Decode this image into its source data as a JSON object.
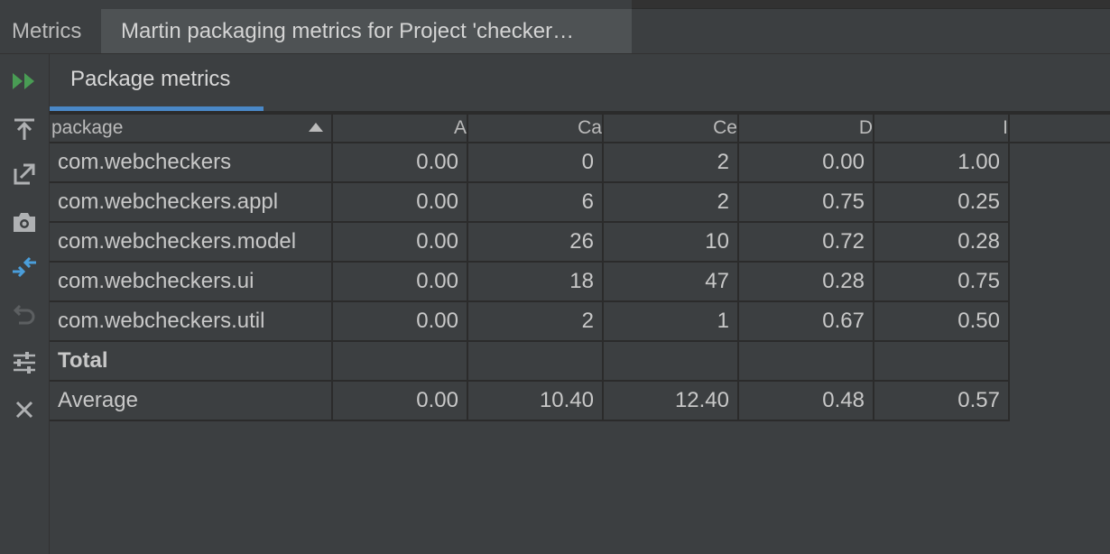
{
  "toolwindow": {
    "label": "Metrics",
    "tab_title": "Martin packaging metrics for Project 'checker…"
  },
  "toolbar": {
    "buttons": [
      {
        "icon": "rerun-icon"
      },
      {
        "icon": "export-icon"
      },
      {
        "icon": "open-external-icon"
      },
      {
        "icon": "snapshot-icon"
      },
      {
        "icon": "compare-icon"
      },
      {
        "icon": "undo-icon"
      },
      {
        "icon": "settings-sliders-icon"
      },
      {
        "icon": "close-icon"
      }
    ],
    "colors": {
      "rerun": "#499c54",
      "compare": "#4a9edb",
      "normal": "#afb1b3",
      "disabled": "#5c5f61"
    }
  },
  "content_tab": {
    "label": "Package metrics",
    "accent": "#4a88c7"
  },
  "table": {
    "columns": [
      "package",
      "A",
      "Ca",
      "Ce",
      "D",
      "I"
    ],
    "sorted_by": "package",
    "rows": [
      {
        "package": "com.webcheckers",
        "A": "0.00",
        "Ca": "0",
        "Ce": "2",
        "D": "0.00",
        "I": "1.00"
      },
      {
        "package": "com.webcheckers.appl",
        "A": "0.00",
        "Ca": "6",
        "Ce": "2",
        "D": "0.75",
        "I": "0.25"
      },
      {
        "package": "com.webcheckers.model",
        "A": "0.00",
        "Ca": "26",
        "Ce": "10",
        "D": "0.72",
        "I": "0.28"
      },
      {
        "package": "com.webcheckers.ui",
        "A": "0.00",
        "Ca": "18",
        "Ce": "47",
        "D": "0.28",
        "I": "0.75"
      },
      {
        "package": "com.webcheckers.util",
        "A": "0.00",
        "Ca": "2",
        "Ce": "1",
        "D": "0.67",
        "I": "0.50"
      },
      {
        "package": "Total",
        "A": "",
        "Ca": "",
        "Ce": "",
        "D": "",
        "I": ""
      },
      {
        "package": "Average",
        "A": "0.00",
        "Ca": "10.40",
        "Ce": "12.40",
        "D": "0.48",
        "I": "0.57"
      }
    ]
  }
}
